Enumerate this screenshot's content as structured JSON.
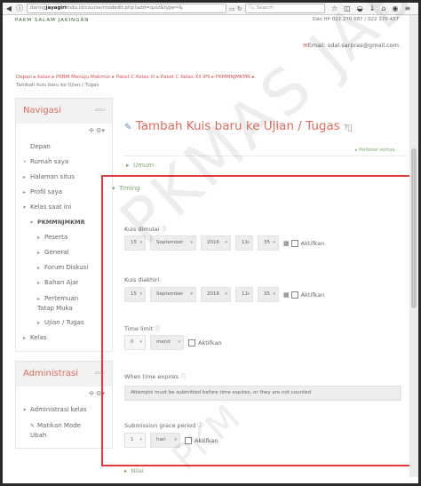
{
  "browser": {
    "url_prefix": "daring",
    "url_domain": "jayagiri",
    "url_suffix": "mdu.id/course/modedit.php?add=quiz&type=&",
    "search_placeholder": "Search",
    "back_icon": "back-arrow-icon",
    "info_icon": "info-icon"
  },
  "header": {
    "logo_text": "PAKM SALAM JAKINGAN",
    "phone": "Dan HP 022 270 687 / 022 270 427",
    "email": "Email: sdal.sarpras@gmail.com"
  },
  "breadcrumb": {
    "items": [
      "Depan",
      "Kelas",
      "PKBM Menuju Makmur",
      "Paket C Kelas XI",
      "Paket C Kelas XII IPS",
      "PKMMNJMKMR"
    ],
    "current": "Tambah kuis baru ke Ujian / Tugas"
  },
  "sidebar": {
    "nav_title": "Navigasi",
    "nav_items": [
      {
        "label": "Depan",
        "marker": ""
      },
      {
        "label": "Rumah saya",
        "marker": "•"
      },
      {
        "label": "Halaman situs",
        "marker": "▸"
      },
      {
        "label": "Profil saya",
        "marker": "▸"
      },
      {
        "label": "Kelas saat ini",
        "marker": "▾"
      },
      {
        "label": "PKMMNJMKMR",
        "marker": "▾"
      },
      {
        "label": "Peserta",
        "marker": "▸"
      },
      {
        "label": "General",
        "marker": "▸"
      },
      {
        "label": "Forum Diskusi",
        "marker": "▸"
      },
      {
        "label": "Bahan Ajar",
        "marker": "▸"
      },
      {
        "label": "Pertemuan Tatap Muka",
        "marker": "▸"
      },
      {
        "label": "Ujian / Tugas",
        "marker": "▸"
      },
      {
        "label": "Kelas",
        "marker": "▸"
      }
    ],
    "admin_title": "Administrasi",
    "admin_items": [
      {
        "label": "Administrasi kelas",
        "marker": "▾"
      },
      {
        "label": "Matikan Mode Ubah",
        "marker": "✎"
      }
    ]
  },
  "main": {
    "title": "Tambah Kuis baru ke Ujian / Tugas",
    "expand_all": "Perbesar semua",
    "section_umum": "Umum",
    "section_timing": "Timing",
    "open_label": "Kuis dimulai",
    "open": {
      "day": "15",
      "month": "September",
      "year": "2016",
      "hour": "11",
      "minute": "35",
      "enable": "Aktifkan"
    },
    "close_label": "Kuis diakhiri",
    "close": {
      "day": "15",
      "month": "September",
      "year": "2016",
      "hour": "11",
      "minute": "35",
      "enable": "Aktifkan"
    },
    "time_limit_label": "Time limit",
    "time_limit": {
      "value": "0",
      "unit": "menit",
      "enable": "Aktifkan"
    },
    "when_expires_label": "When time expires",
    "when_expires_value": "Attempts must be submitted before time expires, or they are not counted",
    "grace_label": "Submission grace period",
    "grace": {
      "value": "1",
      "unit": "hari",
      "enable": "Aktifkan"
    },
    "section_nilai": "Nilai"
  },
  "watermark": {
    "line1": "PKMAS JAB",
    "line2": "PKM"
  },
  "colors": {
    "accent": "#e06c5a",
    "link": "#d9534f",
    "green": "#7aa66a",
    "highlight": "#e53a3a"
  }
}
